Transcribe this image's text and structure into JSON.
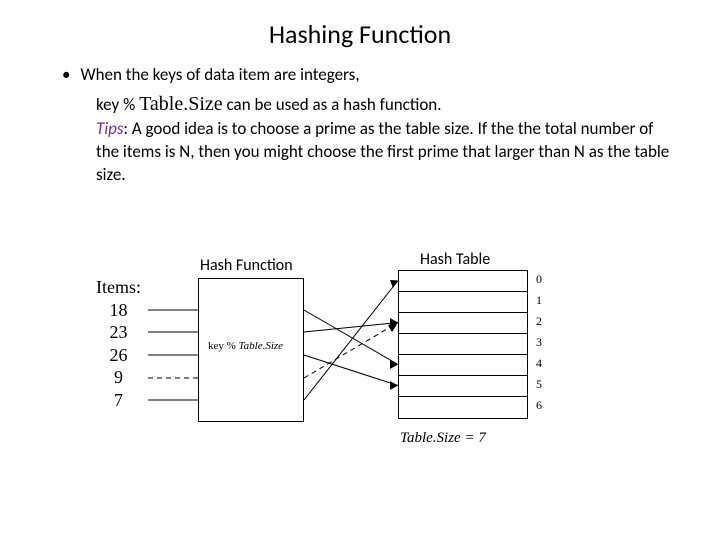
{
  "title": "Hashing Function",
  "bullet1": "When the keys of data item are integers,",
  "line2_pre": "key % ",
  "line2_ts": "Table.Size",
  "line2_post": " can be used as a hash function.",
  "tips_label": "Tips",
  "tips_body": ": A good idea is to choose a prime as the table size. If the the total number of the items is N, then you might choose the first prime that larger than N as the table size.",
  "diagram": {
    "items_heading": "Items:",
    "items": [
      "18",
      "23",
      "26",
      "9",
      "7"
    ],
    "hash_function_label": "Hash Function",
    "hash_function_inner_pre": "key % ",
    "hash_function_inner_ts": "Table.Size",
    "hash_table_label": "Hash Table",
    "table_indices": [
      "0",
      "1",
      "2",
      "3",
      "4",
      "5",
      "6"
    ],
    "table_size_label": "Table.Size = 7"
  }
}
